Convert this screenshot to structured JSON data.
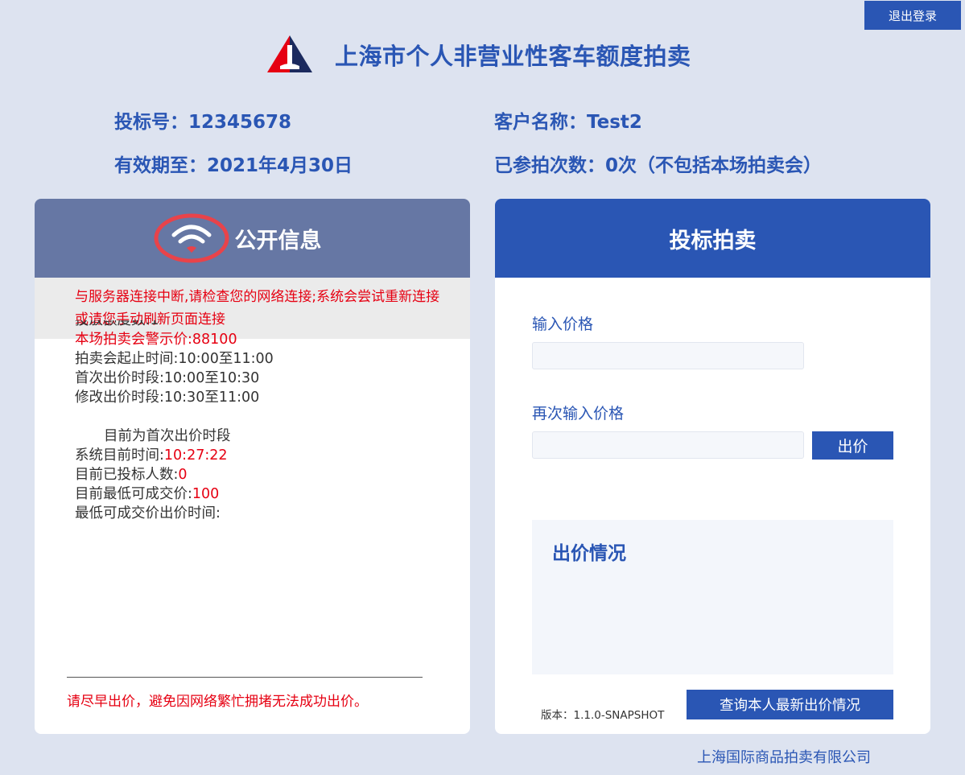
{
  "header": {
    "logout_label": "退出登录",
    "title": "上海市个人非营业性客车额度拍卖"
  },
  "user_info": {
    "bid_number": "投标号：12345678",
    "customer_name": "客户名称：Test2",
    "valid_until": "有效期至：2021年4月30日",
    "participation": "已参拍次数：0次（不包括本场拍卖会）"
  },
  "public_panel": {
    "title": "公开信息",
    "icon": "wifi-icon",
    "warning": "与服务器连接中断,请检查您的网络连接;系统会尝试重新连接或请您手动刷新页面连接",
    "clipped_line": "投放额度数:1",
    "warning_price_label": "本场拍卖会警示价:",
    "warning_price_value": "88100",
    "session_time": "拍卖会起止时间:10:00至11:00",
    "first_bid_period": "首次出价时段:10:00至10:30",
    "modify_bid_period": "修改出价时段:10:30至11:00",
    "current_period": "目前为首次出价时段",
    "system_time_label": "系统目前时间:",
    "system_time_value": "10:27:22",
    "bidders_label": "目前已投标人数:",
    "bidders_value": "0",
    "lowest_price_label": "目前最低可成交价:",
    "lowest_price_value": "100",
    "lowest_price_time_label": "最低可成交价出价时间:",
    "bottom_tip": "请尽早出价，避免因网络繁忙拥堵无法成功出价。"
  },
  "bid_panel": {
    "title": "投标拍卖",
    "price_label": "输入价格",
    "price_value": "",
    "confirm_price_label": "再次输入价格",
    "confirm_price_value": "",
    "bid_button": "出价",
    "status_title": "出价情况",
    "version": "版本：1.1.0-SNAPSHOT",
    "query_button": "查询本人最新出价情况"
  },
  "footer": {
    "company": "上海国际商品拍卖有限公司"
  },
  "colors": {
    "primary": "#2a56b4",
    "left_header": "#6677a4",
    "background": "#dde3f0",
    "alert_red": "#e60012",
    "logo_red": "#e60012",
    "logo_navy": "#1b2a5e",
    "wifi_highlight": "#e8434a"
  }
}
